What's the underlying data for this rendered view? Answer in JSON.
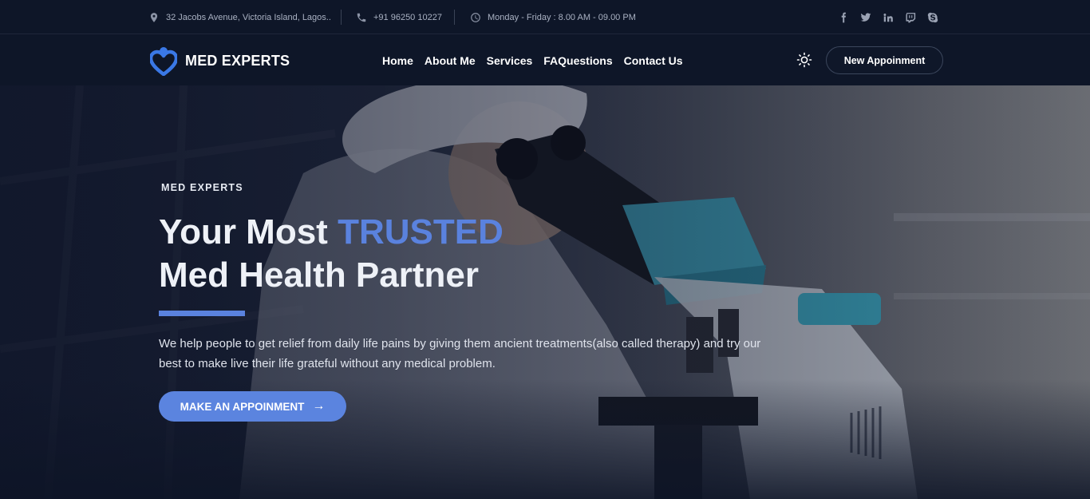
{
  "topbar": {
    "address": "32 Jacobs Avenue, Victoria Island, Lagos..",
    "phone": "+91 96250 10227",
    "hours": "Monday - Friday : 8.00 AM - 09.00 PM",
    "socials": [
      "facebook-icon",
      "twitter-icon",
      "linkedin-icon",
      "twitch-icon",
      "skype-icon"
    ]
  },
  "nav": {
    "brand": "MED EXPERTS",
    "links": [
      "Home",
      "About Me",
      "Services",
      "FAQuestions",
      "Contact Us"
    ],
    "cta": "New Appoinment"
  },
  "hero": {
    "eyebrow": "MED EXPERTS",
    "title_part1": "Your Most ",
    "title_accent": "TRUSTED",
    "title_line2": "Med Health Partner",
    "description": "We help people to get relief from daily life pains by giving them ancient treatments(also called therapy) and try our best to make live their life grateful without any medical problem.",
    "cta": "MAKE AN APPOINMENT",
    "cta_arrow": "→"
  },
  "colors": {
    "accent": "#5a82de",
    "background": "#0e1628"
  }
}
